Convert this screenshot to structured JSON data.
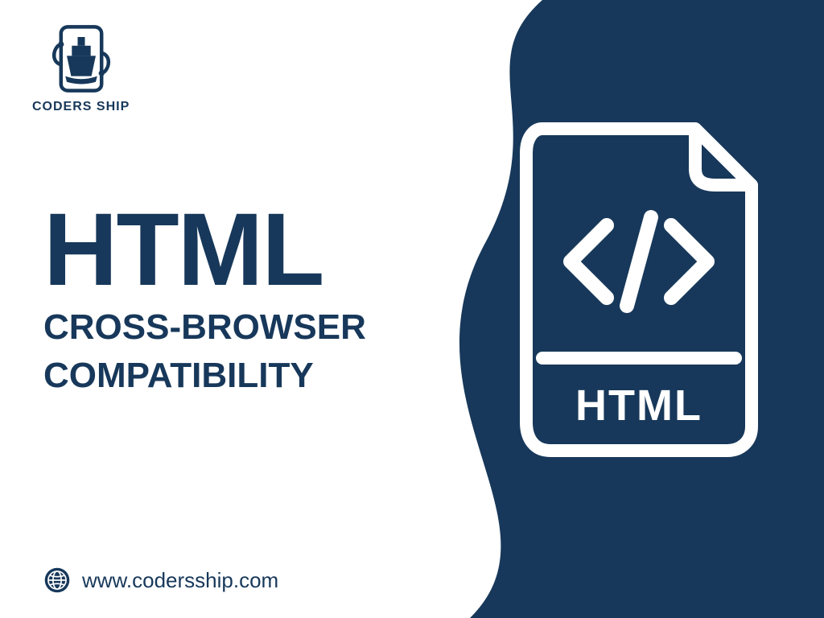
{
  "brand": {
    "name": "CODERS SHIP"
  },
  "headline": {
    "title": "HTML",
    "line1": "CROSS-BROWSER",
    "line2": "COMPATIBILITY"
  },
  "footer": {
    "url": "www.codersship.com"
  },
  "illustration": {
    "file_label": "HTML"
  },
  "colors": {
    "primary": "#17385a",
    "background": "#ffffff"
  }
}
